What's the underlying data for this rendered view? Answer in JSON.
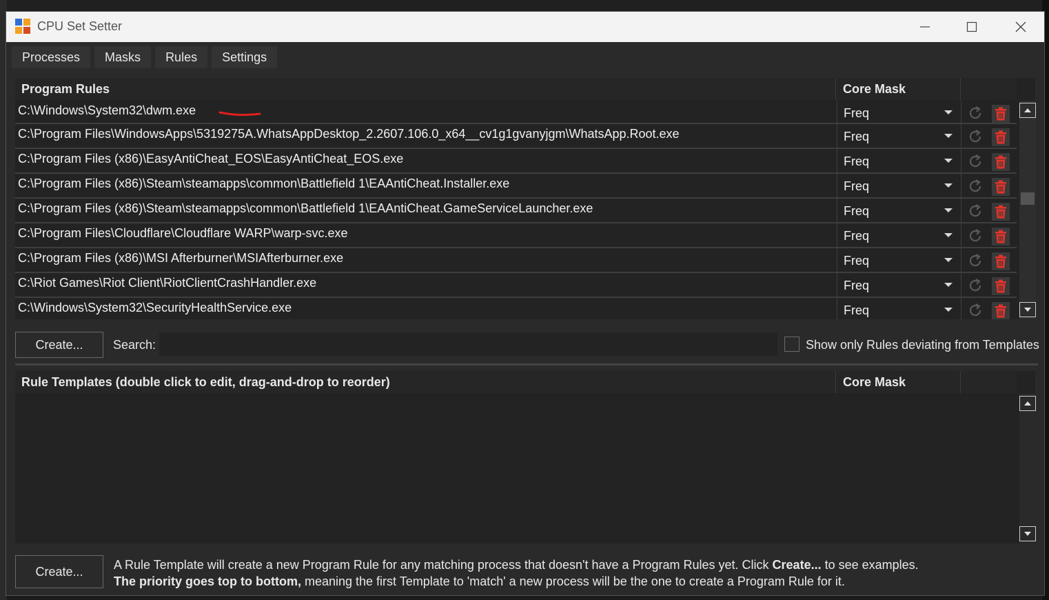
{
  "window": {
    "title": "CPU Set Setter"
  },
  "tabs": [
    {
      "label": "Processes"
    },
    {
      "label": "Masks"
    },
    {
      "label": "Rules"
    },
    {
      "label": "Settings"
    }
  ],
  "program_rules": {
    "header_program": "Program Rules",
    "header_core": "Core Mask",
    "rows": [
      {
        "path": "C:\\Windows\\System32\\dwm.exe",
        "core": "Freq"
      },
      {
        "path": "C:\\Program Files\\WindowsApps\\5319275A.WhatsAppDesktop_2.2607.106.0_x64__cv1g1gvanyjgm\\WhatsApp.Root.exe",
        "core": "Freq"
      },
      {
        "path": "C:\\Program Files (x86)\\EasyAntiCheat_EOS\\EasyAntiCheat_EOS.exe",
        "core": "Freq"
      },
      {
        "path": "C:\\Program Files (x86)\\Steam\\steamapps\\common\\Battlefield 1\\EAAntiCheat.Installer.exe",
        "core": "Freq"
      },
      {
        "path": "C:\\Program Files (x86)\\Steam\\steamapps\\common\\Battlefield 1\\EAAntiCheat.GameServiceLauncher.exe",
        "core": "Freq"
      },
      {
        "path": "C:\\Program Files\\Cloudflare\\Cloudflare WARP\\warp-svc.exe",
        "core": "Freq"
      },
      {
        "path": "C:\\Program Files (x86)\\MSI Afterburner\\MSIAfterburner.exe",
        "core": "Freq"
      },
      {
        "path": "C:\\Riot Games\\Riot Client\\RiotClientCrashHandler.exe",
        "core": "Freq"
      },
      {
        "path": "C:\\Windows\\System32\\SecurityHealthService.exe",
        "core": "Freq"
      }
    ]
  },
  "search": {
    "create_label": "Create...",
    "label": "Search:",
    "value": "",
    "filter_label": "Show only Rules deviating from Templates",
    "filter_checked": false
  },
  "templates": {
    "header_name": "Rule Templates (double click to edit, drag-and-drop to reorder)",
    "header_core": "Core Mask",
    "create_label": "Create...",
    "info_line1_a": "A Rule Template will create a new Program Rule for any matching process that doesn't have a Program Rules yet. Click ",
    "info_line1_b": "Create...",
    "info_line1_c": " to see examples.",
    "info_line2_a": "The priority goes top to bottom,",
    "info_line2_b": " meaning the first Template to 'match' a new process will be the one to create a Program Rule for it."
  },
  "colors": {
    "delete_red": "#e5332a",
    "annotation_red": "#e0201f"
  },
  "icons": {
    "reset": "refresh-icon",
    "delete": "trash-icon"
  }
}
